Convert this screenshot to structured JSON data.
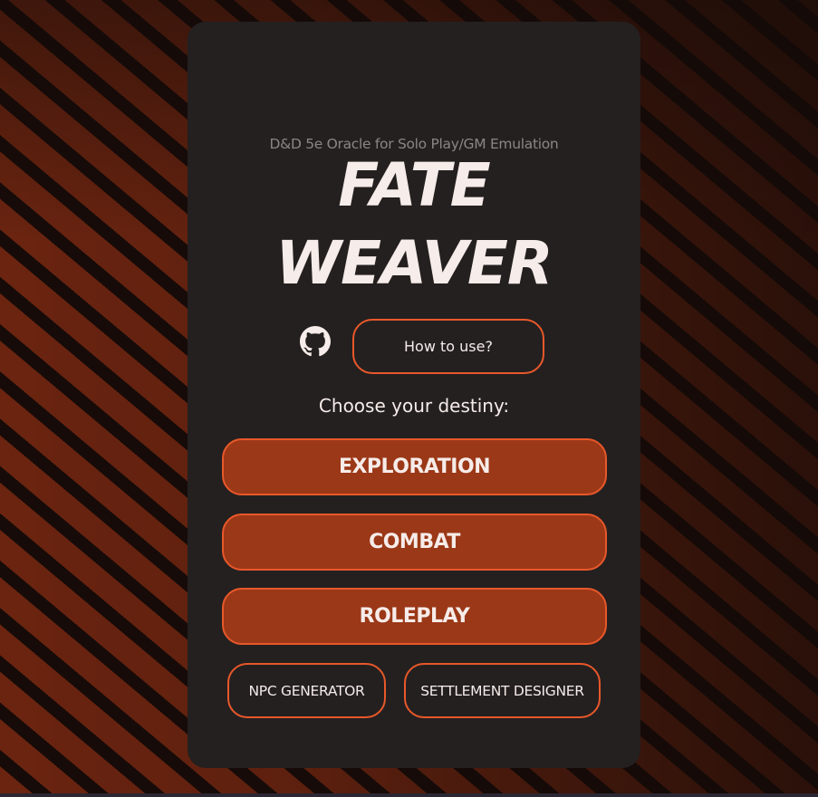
{
  "header": {
    "subtitle": "D&D 5e Oracle for Solo Play/GM Emulation",
    "title_line1": "FATE",
    "title_line2": "WEAVER"
  },
  "links": {
    "github_icon": "github-icon",
    "how_to_use_label": "How to use?"
  },
  "prompt": "Choose your destiny:",
  "main_buttons": {
    "exploration": "EXPLORATION",
    "combat": "COMBAT",
    "roleplay": "ROLEPLAY"
  },
  "secondary_buttons": {
    "npc_generator": "NPC GENERATOR",
    "settlement_designer": "SETTLEMENT DESIGNER"
  },
  "colors": {
    "card_background": "#242020",
    "accent_border": "#e8582a",
    "button_fill": "#9b3817",
    "text_primary": "#f6ece9",
    "text_muted": "#8c8584",
    "stripe_dark": "#160b08",
    "stripe_rust": "#6b2410"
  }
}
